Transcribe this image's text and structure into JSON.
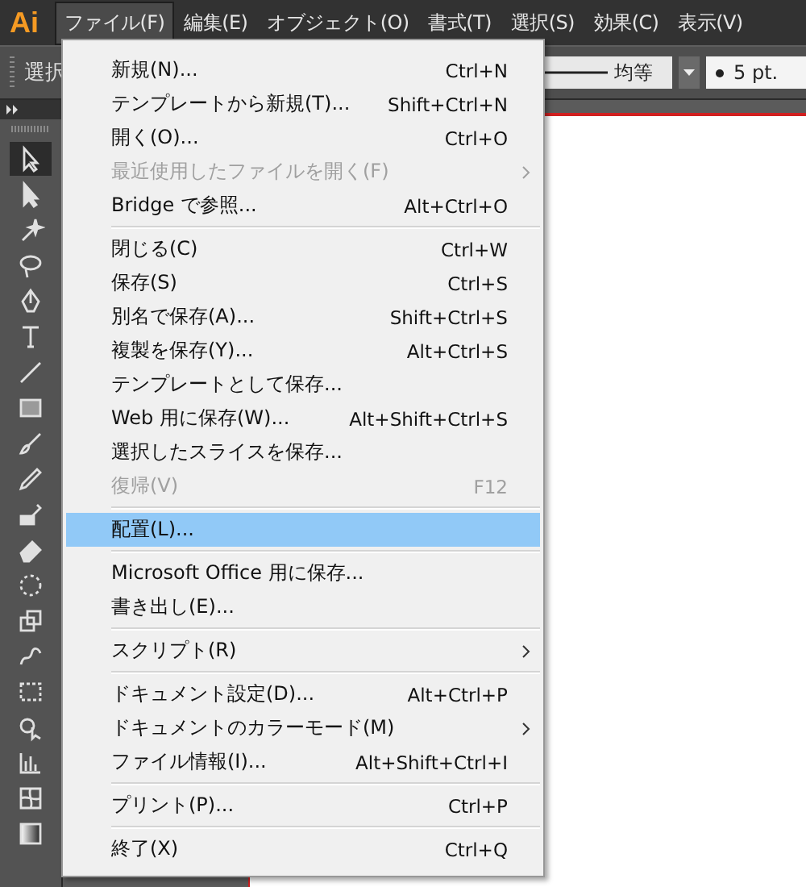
{
  "app_logo": "Ai",
  "menubar": [
    {
      "label": "ファイル(F)",
      "selected": true
    },
    {
      "label": "編集(E)",
      "selected": false
    },
    {
      "label": "オブジェクト(O)",
      "selected": false
    },
    {
      "label": "書式(T)",
      "selected": false
    },
    {
      "label": "選択(S)",
      "selected": false
    },
    {
      "label": "効果(C)",
      "selected": false
    },
    {
      "label": "表示(V)",
      "selected": false
    }
  ],
  "control_bar": {
    "label": "選択",
    "stroke_profile": "均等",
    "brush_size": "5 pt."
  },
  "file_menu": [
    {
      "kind": "item",
      "label": "新規(N)...",
      "shortcut": "Ctrl+N",
      "disabled": false,
      "submenu": false,
      "selected": false
    },
    {
      "kind": "item",
      "label": "テンプレートから新規(T)...",
      "shortcut": "Shift+Ctrl+N",
      "disabled": false,
      "submenu": false,
      "selected": false
    },
    {
      "kind": "item",
      "label": "開く(O)...",
      "shortcut": "Ctrl+O",
      "disabled": false,
      "submenu": false,
      "selected": false
    },
    {
      "kind": "item",
      "label": "最近使用したファイルを開く(F)",
      "disabled": true,
      "submenu": true,
      "selected": false
    },
    {
      "kind": "item",
      "label": "Bridge で参照...",
      "shortcut": "Alt+Ctrl+O",
      "disabled": false,
      "submenu": false,
      "selected": false
    },
    {
      "kind": "separator"
    },
    {
      "kind": "item",
      "label": "閉じる(C)",
      "shortcut": "Ctrl+W",
      "disabled": false,
      "submenu": false,
      "selected": false
    },
    {
      "kind": "item",
      "label": "保存(S)",
      "shortcut": "Ctrl+S",
      "disabled": false,
      "submenu": false,
      "selected": false
    },
    {
      "kind": "item",
      "label": "別名で保存(A)...",
      "shortcut": "Shift+Ctrl+S",
      "disabled": false,
      "submenu": false,
      "selected": false
    },
    {
      "kind": "item",
      "label": "複製を保存(Y)...",
      "shortcut": "Alt+Ctrl+S",
      "disabled": false,
      "submenu": false,
      "selected": false
    },
    {
      "kind": "item",
      "label": "テンプレートとして保存...",
      "disabled": false,
      "submenu": false,
      "selected": false
    },
    {
      "kind": "item",
      "label": "Web 用に保存(W)...",
      "shortcut": "Alt+Shift+Ctrl+S",
      "disabled": false,
      "submenu": false,
      "selected": false
    },
    {
      "kind": "item",
      "label": "選択したスライスを保存...",
      "disabled": false,
      "submenu": false,
      "selected": false
    },
    {
      "kind": "item",
      "label": "復帰(V)",
      "shortcut": "F12",
      "disabled": true,
      "submenu": false,
      "selected": false
    },
    {
      "kind": "separator"
    },
    {
      "kind": "item",
      "label": "配置(L)...",
      "disabled": false,
      "submenu": false,
      "selected": true
    },
    {
      "kind": "separator"
    },
    {
      "kind": "item",
      "label": "Microsoft Office 用に保存...",
      "disabled": false,
      "submenu": false,
      "selected": false
    },
    {
      "kind": "item",
      "label": "書き出し(E)...",
      "disabled": false,
      "submenu": false,
      "selected": false
    },
    {
      "kind": "separator"
    },
    {
      "kind": "item",
      "label": "スクリプト(R)",
      "disabled": false,
      "submenu": true,
      "selected": false
    },
    {
      "kind": "separator"
    },
    {
      "kind": "item",
      "label": "ドキュメント設定(D)...",
      "shortcut": "Alt+Ctrl+P",
      "disabled": false,
      "submenu": false,
      "selected": false
    },
    {
      "kind": "item",
      "label": "ドキュメントのカラーモード(M)",
      "disabled": false,
      "submenu": true,
      "selected": false
    },
    {
      "kind": "item",
      "label": "ファイル情報(I)...",
      "shortcut": "Alt+Shift+Ctrl+I",
      "disabled": false,
      "submenu": false,
      "selected": false
    },
    {
      "kind": "separator"
    },
    {
      "kind": "item",
      "label": "プリント(P)...",
      "shortcut": "Ctrl+P",
      "disabled": false,
      "submenu": false,
      "selected": false
    },
    {
      "kind": "separator"
    },
    {
      "kind": "item",
      "label": "終了(X)",
      "shortcut": "Ctrl+Q",
      "disabled": false,
      "submenu": false,
      "selected": false
    }
  ]
}
